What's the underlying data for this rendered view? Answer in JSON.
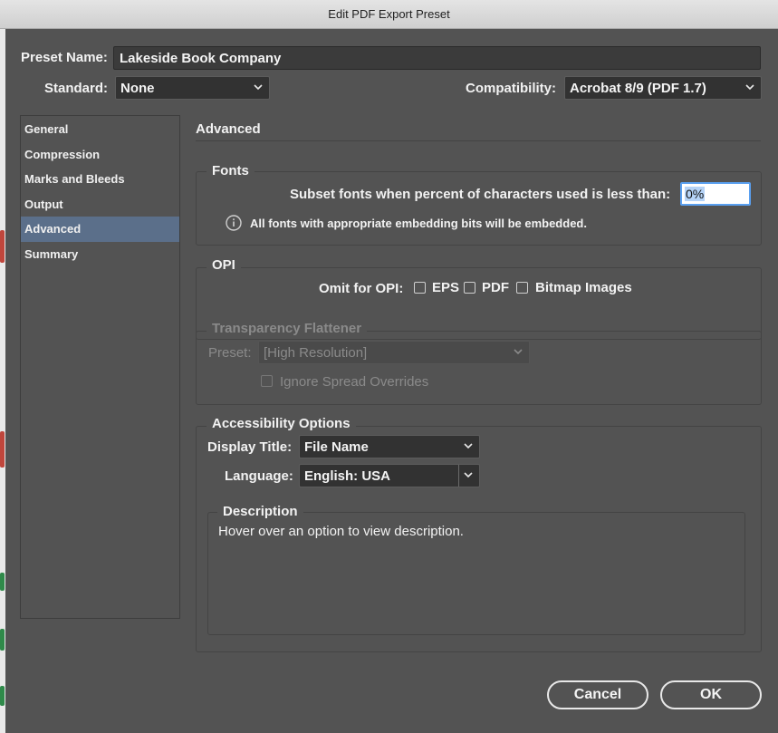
{
  "window": {
    "title": "Edit PDF Export Preset"
  },
  "preset": {
    "label": "Preset Name:",
    "value": "Lakeside Book Company"
  },
  "standard": {
    "label": "Standard:",
    "value": "None"
  },
  "compatibility": {
    "label": "Compatibility:",
    "value": "Acrobat 8/9 (PDF 1.7)"
  },
  "sidebar": {
    "items": [
      {
        "label": "General"
      },
      {
        "label": "Compression"
      },
      {
        "label": "Marks and Bleeds"
      },
      {
        "label": "Output"
      },
      {
        "label": "Advanced",
        "selected": true
      },
      {
        "label": "Summary"
      }
    ]
  },
  "section": {
    "title": "Advanced"
  },
  "fonts": {
    "title": "Fonts",
    "subset_label": "Subset fonts when percent of characters used is less than:",
    "subset_value": "0%",
    "info_text": "All fonts with appropriate embedding bits will be embedded."
  },
  "opi": {
    "title": "OPI",
    "omit_label": "Omit for OPI:",
    "eps_label": "EPS",
    "pdf_label": "PDF",
    "bitmap_label": "Bitmap Images"
  },
  "transparency": {
    "title": "Transparency Flattener",
    "preset_label": "Preset:",
    "preset_value": "[High Resolution]",
    "ignore_label": "Ignore Spread Overrides"
  },
  "accessibility": {
    "title": "Accessibility Options",
    "display_title_label": "Display Title:",
    "display_title_value": "File Name",
    "language_label": "Language:",
    "language_value": "English: USA"
  },
  "description": {
    "title": "Description",
    "text": "Hover over an option to view description."
  },
  "buttons": {
    "cancel": "Cancel",
    "ok": "OK"
  },
  "colors": {
    "selected_row": "#5b6f8a",
    "focus_ring": "#5aa0f0",
    "panel_bg": "#535353"
  }
}
